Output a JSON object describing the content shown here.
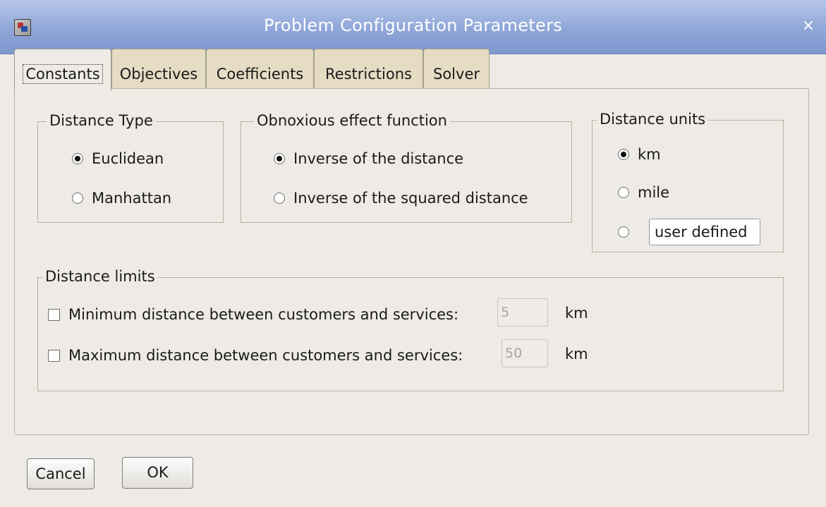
{
  "window": {
    "title": "Problem Configuration Parameters",
    "close_glyph": "×",
    "icon": "app-icon"
  },
  "tabs": [
    {
      "label": "Constants",
      "active": true
    },
    {
      "label": "Objectives",
      "active": false
    },
    {
      "label": "Coefficients",
      "active": false
    },
    {
      "label": "Restrictions",
      "active": false
    },
    {
      "label": "Solver",
      "active": false
    }
  ],
  "distance_type": {
    "legend": "Distance Type",
    "options": [
      {
        "label": "Euclidean",
        "checked": true
      },
      {
        "label": "Manhattan",
        "checked": false
      }
    ]
  },
  "obnoxious": {
    "legend": "Obnoxious effect function",
    "options": [
      {
        "label": "Inverse of the distance",
        "checked": true
      },
      {
        "label": "Inverse of the squared distance",
        "checked": false
      }
    ]
  },
  "distance_units": {
    "legend": "Distance units",
    "options": [
      {
        "label": "km",
        "checked": true
      },
      {
        "label": "mile",
        "checked": false
      },
      {
        "label": "",
        "checked": false
      }
    ],
    "user_defined_value": "user defined"
  },
  "distance_limits": {
    "legend": "Distance limits",
    "rows": [
      {
        "label": "Minimum distance between customers and services:",
        "checked": false,
        "value": "5",
        "unit": "km"
      },
      {
        "label": "Maximum distance between customers and services:",
        "checked": false,
        "value": "50",
        "unit": "km"
      }
    ]
  },
  "buttons": {
    "cancel": "Cancel",
    "ok": "OK"
  }
}
